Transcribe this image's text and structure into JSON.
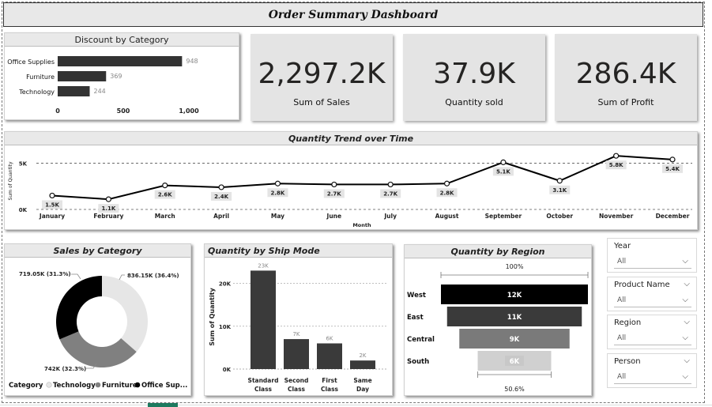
{
  "dashboard": {
    "title": "Order Summary Dashboard"
  },
  "kpis": [
    {
      "value": "2,297.2K",
      "label": "Sum of Sales"
    },
    {
      "value": "37.9K",
      "label": "Quantity sold"
    },
    {
      "value": "286.4K",
      "label": "Sum of Profit"
    }
  ],
  "slicers": [
    {
      "label": "Year",
      "value": "All"
    },
    {
      "label": "Product Name",
      "value": "All"
    },
    {
      "label": "Region",
      "value": "All"
    },
    {
      "label": "Person",
      "value": "All"
    }
  ],
  "colors": {
    "bar_dark": "#3a3a3a",
    "panel": "#e4e4e4",
    "line": "#000000"
  },
  "chart_data": [
    {
      "type": "bar",
      "orientation": "horizontal",
      "title": "Discount by Category",
      "categories": [
        "Office Supplies",
        "Furniture",
        "Technology"
      ],
      "values": [
        948,
        369,
        244
      ],
      "data_labels": [
        "948",
        "369",
        "244"
      ],
      "xlim": [
        0,
        1000
      ],
      "xticks": [
        "0",
        "500",
        "1,000"
      ]
    },
    {
      "type": "line",
      "title": "Quantity Trend over Time",
      "xlabel": "Month",
      "ylabel": "Sum of Quantity",
      "categories": [
        "January",
        "February",
        "March",
        "April",
        "May",
        "June",
        "July",
        "August",
        "September",
        "October",
        "November",
        "December"
      ],
      "values": [
        1500,
        1100,
        2600,
        2400,
        2800,
        2700,
        2700,
        2800,
        5100,
        3100,
        5800,
        5400
      ],
      "data_labels": [
        "1.5K",
        "1.1K",
        "2.6K",
        "2.4K",
        "2.8K",
        "2.7K",
        "2.7K",
        "2.8K",
        "5.1K",
        "3.1K",
        "5.8K",
        "5.4K"
      ],
      "yticks": [
        "0K",
        "5K"
      ],
      "ylim": [
        0,
        6500
      ]
    },
    {
      "type": "pie",
      "subtype": "donut",
      "title": "Sales by Category",
      "legend_title": "Category",
      "categories": [
        "Technology",
        "Furniture",
        "Office Sup..."
      ],
      "values": [
        836.15,
        742,
        719.05
      ],
      "data_labels": [
        "836.15K (36.4%)",
        "742K (32.3%)",
        "719.05K (31.3%)"
      ],
      "colors": [
        "#e6e6e6",
        "#808080",
        "#000000"
      ]
    },
    {
      "type": "bar",
      "title": "Quantity by Ship Mode",
      "ylabel": "Sum of Quantity",
      "categories": [
        [
          "Standard",
          "Class"
        ],
        [
          "Second",
          "Class"
        ],
        [
          "First",
          "Class"
        ],
        [
          "Same",
          "Day"
        ]
      ],
      "values": [
        23000,
        7000,
        6000,
        2000
      ],
      "data_labels": [
        "23K",
        "7K",
        "6K",
        "2K"
      ],
      "yticks": [
        "0K",
        "10K",
        "20K"
      ],
      "ylim": [
        0,
        24000
      ]
    },
    {
      "type": "funnel",
      "title": "Quantity by Region",
      "categories": [
        "West",
        "East",
        "Central",
        "South"
      ],
      "values": [
        12000,
        11000,
        9000,
        6000
      ],
      "data_labels": [
        "12K",
        "11K",
        "9K",
        "6K"
      ],
      "top_label": "100%",
      "bottom_label": "50.6%",
      "colors": [
        "#000000",
        "#3a3a3a",
        "#7a7a7a",
        "#d0d0d0"
      ]
    }
  ]
}
